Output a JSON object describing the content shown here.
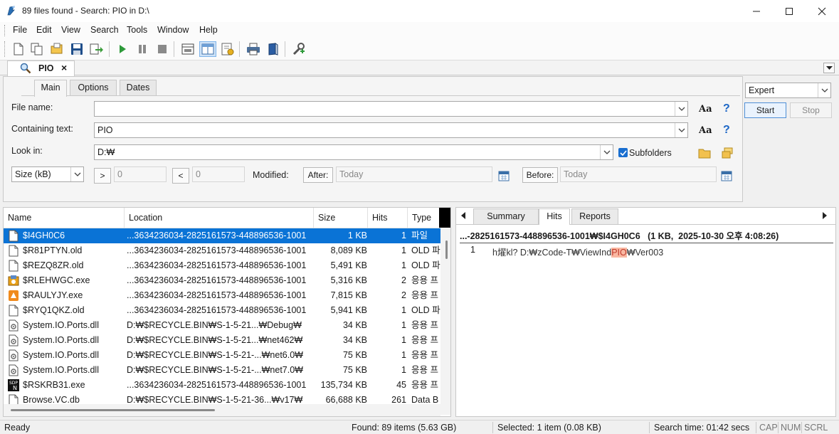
{
  "window": {
    "title": "89 files found - Search: PIO in D:\\"
  },
  "menu": [
    "File",
    "Edit",
    "View",
    "Search",
    "Tools",
    "Window",
    "Help"
  ],
  "doc_tab": {
    "label": "PIO",
    "close": "×"
  },
  "search_tabs": [
    "Main",
    "Options",
    "Dates"
  ],
  "form": {
    "file_name_label": "File name:",
    "file_name_value": "",
    "containing_label": "Containing text:",
    "containing_value": "PIO",
    "look_in_label": "Look in:",
    "look_in_value": "D:₩",
    "subfolders_label": "Subfolders",
    "subfolders_checked": true,
    "case_glyph": "Aa",
    "help_glyph": "?",
    "size_select": "Size (kB)",
    "gt_label": ">",
    "gt_value": "0",
    "lt_label": "<",
    "lt_value": "0",
    "modified_label": "Modified:",
    "after_label": "After:",
    "after_value": "Today",
    "before_label": "Before:",
    "before_value": "Today"
  },
  "side": {
    "mode": "Expert",
    "start": "Start",
    "stop": "Stop"
  },
  "columns": [
    "Name",
    "Location",
    "Size",
    "Hits",
    "Type"
  ],
  "rows": [
    {
      "name": "$I4GH0C6",
      "location": "...3634236034-2825161573-448896536-1001",
      "size": "1 KB",
      "hits": "1",
      "type": "파일",
      "icon": "file-icon"
    },
    {
      "name": "$R81PTYN.old",
      "location": "...3634236034-2825161573-448896536-1001",
      "size": "8,089 KB",
      "hits": "1",
      "type": "OLD 파",
      "icon": "file-icon"
    },
    {
      "name": "$REZQ8ZR.old",
      "location": "...3634236034-2825161573-448896536-1001",
      "size": "5,491 KB",
      "hits": "1",
      "type": "OLD 파",
      "icon": "file-icon"
    },
    {
      "name": "$RLEHWGC.exe",
      "location": "...3634236034-2825161573-448896536-1001",
      "size": "5,316 KB",
      "hits": "2",
      "type": "응용 프",
      "icon": "installer-icon"
    },
    {
      "name": "$RAULYJY.exe",
      "location": "...3634236034-2825161573-448896536-1001",
      "size": "7,815 KB",
      "hits": "2",
      "type": "응용 프",
      "icon": "app-icon"
    },
    {
      "name": "$RYQ1QKZ.old",
      "location": "...3634236034-2825161573-448896536-1001",
      "size": "5,941 KB",
      "hits": "1",
      "type": "OLD 파",
      "icon": "file-icon"
    },
    {
      "name": "System.IO.Ports.dll",
      "location": "D:₩$RECYCLE.BIN₩S-1-5-21...₩Debug₩",
      "size": "34 KB",
      "hits": "1",
      "type": "응용 프",
      "icon": "dll-icon"
    },
    {
      "name": "System.IO.Ports.dll",
      "location": "D:₩$RECYCLE.BIN₩S-1-5-21...₩net462₩",
      "size": "34 KB",
      "hits": "1",
      "type": "응용 프",
      "icon": "dll-icon"
    },
    {
      "name": "System.IO.Ports.dll",
      "location": "D:₩$RECYCLE.BIN₩S-1-5-21-...₩net6.0₩",
      "size": "75 KB",
      "hits": "1",
      "type": "응용 프",
      "icon": "dll-icon"
    },
    {
      "name": "System.IO.Ports.dll",
      "location": "D:₩$RECYCLE.BIN₩S-1-5-21-...₩net7.0₩",
      "size": "75 KB",
      "hits": "1",
      "type": "응용 프",
      "icon": "dll-icon"
    },
    {
      "name": "$RSKRB31.exe",
      "location": "...3634236034-2825161573-448896536-1001",
      "size": "135,734 KB",
      "hits": "45",
      "type": "응용 프",
      "icon": "sdp-icon"
    },
    {
      "name": "Browse.VC.db",
      "location": "D:₩$RECYCLE.BIN₩S-1-5-21-36...₩v17₩",
      "size": "66,688 KB",
      "hits": "261",
      "type": "Data B",
      "icon": "file-icon"
    }
  ],
  "hits_tabs": [
    "Summary",
    "Hits",
    "Reports"
  ],
  "hits_header": "...-2825161573-448896536-1001₩$I4GH0C6   (1 KB,  2025-10-30 오후 4:08:26)",
  "hit_line": {
    "num": "1",
    "before": "h燿kl? D:₩zCode-T₩ViewInd",
    "match": "PIO",
    "after": "₩Ver003"
  },
  "status": {
    "ready": "Ready",
    "found": "Found: 89 items (5.63 GB)",
    "selected": "Selected: 1 item (0.08 KB)",
    "time": "Search time: 01:42 secs",
    "cap": "CAP",
    "num": "NUM",
    "scrl": "SCRL"
  },
  "colors": {
    "selection": "#0a73d6",
    "highlight": "#f9b8a2"
  }
}
